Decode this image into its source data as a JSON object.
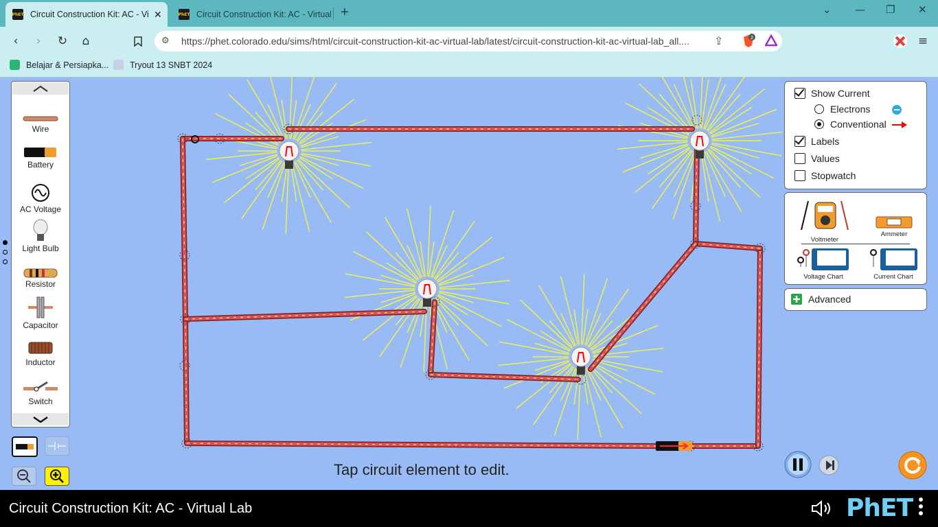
{
  "browser": {
    "tabs": [
      {
        "title": "Circuit Construction Kit: AC - Vir",
        "active": true
      },
      {
        "title": "Circuit Construction Kit: AC - Virtual",
        "active": false
      }
    ],
    "favicon_text": "PhET",
    "url": "https://phet.colorado.edu/sims/html/circuit-construction-kit-ac-virtual-lab/latest/circuit-construction-kit-ac-virtual-lab_all....",
    "brave_badge": "2",
    "bookmarks": [
      {
        "label": "Belajar & Persiapka..."
      },
      {
        "label": "Tryout 13 SNBT 2024"
      }
    ]
  },
  "palette": {
    "items": [
      {
        "label": "Wire"
      },
      {
        "label": "Battery"
      },
      {
        "label": "AC Voltage"
      },
      {
        "label": "Light Bulb"
      },
      {
        "label": "Resistor"
      },
      {
        "label": "Capacitor"
      },
      {
        "label": "Inductor"
      },
      {
        "label": "Switch"
      }
    ]
  },
  "display_options": {
    "show_current": {
      "label": "Show Current",
      "checked": true
    },
    "electrons": {
      "label": "Electrons",
      "selected": false
    },
    "conventional": {
      "label": "Conventional",
      "selected": true
    },
    "labels": {
      "label": "Labels",
      "checked": true
    },
    "values": {
      "label": "Values",
      "checked": false
    },
    "stopwatch": {
      "label": "Stopwatch",
      "checked": false
    }
  },
  "tools": {
    "voltmeter": "Voltmeter",
    "ammeter": "Ammeter",
    "voltage_chart": "Voltage Chart",
    "current_chart": "Current Chart"
  },
  "advanced": {
    "label": "Advanced"
  },
  "hint": "Tap circuit element to edit.",
  "footer": {
    "title": "Circuit Construction Kit: AC - Virtual Lab",
    "logo": "PhET"
  },
  "colors": {
    "canvas": "#99BBF5",
    "wire": "#D9534F",
    "light_rays": "#F3F34A",
    "current_arrow": "#FF0000",
    "electron": "#29ABE2",
    "reset": "#F7931E"
  }
}
